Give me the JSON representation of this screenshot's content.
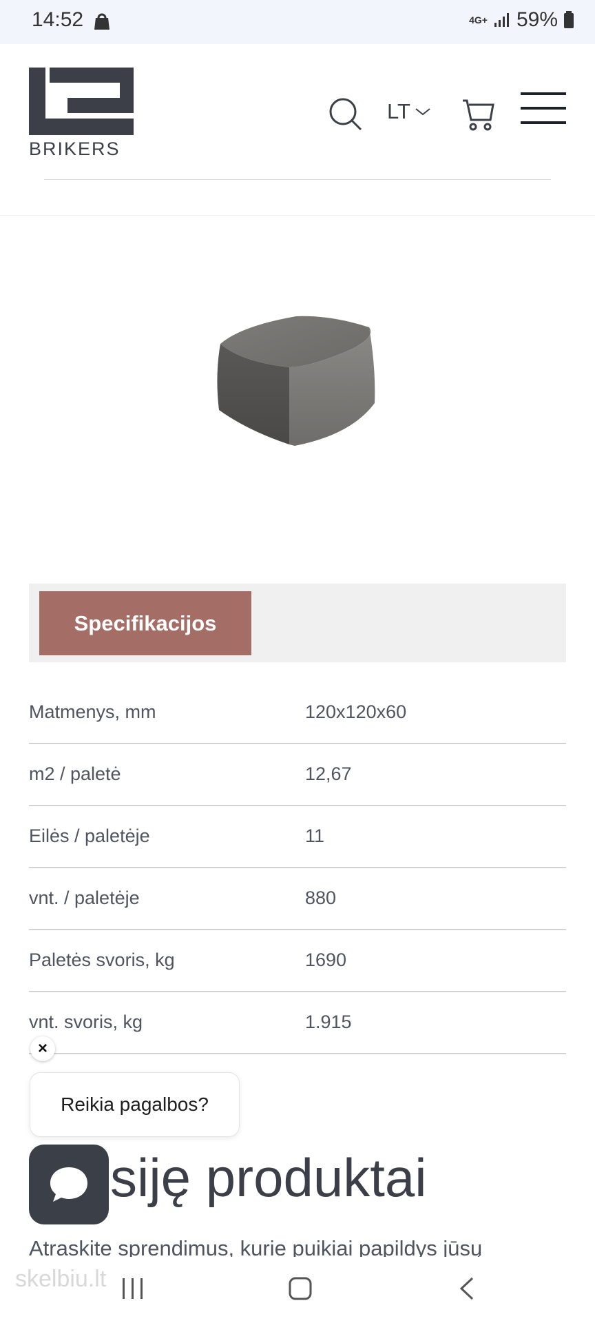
{
  "status_bar": {
    "time": "14:52",
    "network": "4G+",
    "battery": "59%"
  },
  "header": {
    "logo_text": "BRIKERS",
    "language": "LT"
  },
  "tabs": {
    "active": "Specifikacijos"
  },
  "specs": [
    {
      "label": "Matmenys, mm",
      "value": "120x120x60"
    },
    {
      "label": "m2 / paletė",
      "value": "12,67"
    },
    {
      "label": "Eilės / paletėje",
      "value": "11"
    },
    {
      "label": "vnt. / paletėje",
      "value": "880"
    },
    {
      "label": "Paletės svoris, kg",
      "value": "1690"
    },
    {
      "label": "vnt. svoris, kg",
      "value": "1.915"
    }
  ],
  "chat": {
    "help_text": "Reikia pagalbos?",
    "close_symbol": "×"
  },
  "related": {
    "title": "siję produktai",
    "description": "Atraskite sprendimus, kurie puikiai papildys jūsų"
  },
  "watermark": "skelbiu.lt"
}
